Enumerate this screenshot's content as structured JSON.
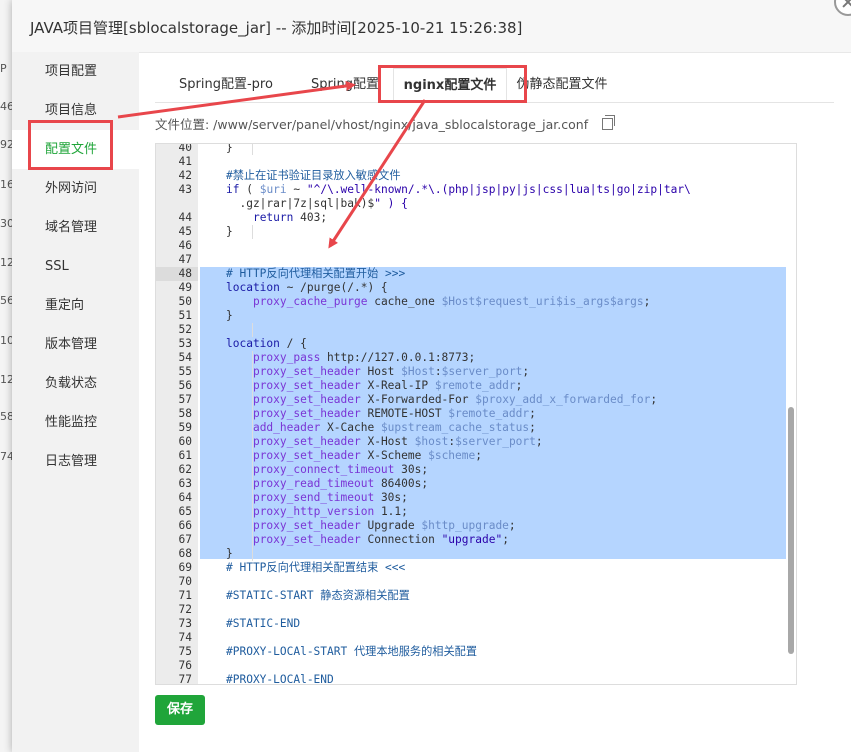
{
  "window": {
    "title": "JAVA项目管理[sblocalstorage_jar] -- 添加时间[2025-10-21 15:26:38]"
  },
  "background_numbers": [
    "P",
    "46",
    "92",
    "16",
    "30",
    "12",
    "56",
    "10",
    "12",
    "58",
    "74"
  ],
  "sidebar": {
    "items": [
      {
        "label": "项目配置"
      },
      {
        "label": "项目信息"
      },
      {
        "label": "配置文件",
        "active": true
      },
      {
        "label": "外网访问"
      },
      {
        "label": "域名管理"
      },
      {
        "label": "SSL"
      },
      {
        "label": "重定向"
      },
      {
        "label": "版本管理"
      },
      {
        "label": "负载状态"
      },
      {
        "label": "性能监控"
      },
      {
        "label": "日志管理"
      }
    ]
  },
  "tabs": [
    {
      "label": "Spring配置-pro"
    },
    {
      "label": "Spring配置"
    },
    {
      "label": "nginx配置文件",
      "active": true
    },
    {
      "label": "伪静态配置文件"
    }
  ],
  "file_path": {
    "label": "文件位置: /www/server/panel/vhost/nginx/java_sblocalstorage_jar.conf"
  },
  "editor": {
    "lines": [
      {
        "n": "40",
        "text": "    }"
      },
      {
        "n": "41",
        "text": ""
      },
      {
        "n": "42",
        "text": "    #禁止在证书验证目录放入敏感文件"
      },
      {
        "n": "43",
        "text": "    if ( $uri ~ \"^/\\.well-known/.*\\.(php|jsp|py|js|css|lua|ts|go|zip|tar\\"
      },
      {
        "n": "",
        "text": "      .gz|rar|7z|sql|bak)$\" ) {"
      },
      {
        "n": "44",
        "text": "        return 403;"
      },
      {
        "n": "45",
        "text": "    }"
      },
      {
        "n": "46",
        "text": ""
      },
      {
        "n": "47",
        "text": ""
      },
      {
        "n": "48",
        "text": "    # HTTP反向代理相关配置开始 >>>"
      },
      {
        "n": "49",
        "text": "    location ~ /purge(/.*) {"
      },
      {
        "n": "50",
        "text": "        proxy_cache_purge cache_one $Host$request_uri$is_args$args;"
      },
      {
        "n": "51",
        "text": "    }"
      },
      {
        "n": "52",
        "text": ""
      },
      {
        "n": "53",
        "text": "    location / {"
      },
      {
        "n": "54",
        "text": "        proxy_pass http://127.0.0.1:8773;"
      },
      {
        "n": "55",
        "text": "        proxy_set_header Host $Host:$server_port;"
      },
      {
        "n": "56",
        "text": "        proxy_set_header X-Real-IP $remote_addr;"
      },
      {
        "n": "57",
        "text": "        proxy_set_header X-Forwarded-For $proxy_add_x_forwarded_for;"
      },
      {
        "n": "58",
        "text": "        proxy_set_header REMOTE-HOST $remote_addr;"
      },
      {
        "n": "59",
        "text": "        add_header X-Cache $upstream_cache_status;"
      },
      {
        "n": "60",
        "text": "        proxy_set_header X-Host $host:$server_port;"
      },
      {
        "n": "61",
        "text": "        proxy_set_header X-Scheme $scheme;"
      },
      {
        "n": "62",
        "text": "        proxy_connect_timeout 30s;"
      },
      {
        "n": "63",
        "text": "        proxy_read_timeout 86400s;"
      },
      {
        "n": "64",
        "text": "        proxy_send_timeout 30s;"
      },
      {
        "n": "65",
        "text": "        proxy_http_version 1.1;"
      },
      {
        "n": "66",
        "text": "        proxy_set_header Upgrade $http_upgrade;"
      },
      {
        "n": "67",
        "text": "        proxy_set_header Connection \"upgrade\";"
      },
      {
        "n": "68",
        "text": "    }"
      },
      {
        "n": "69",
        "text": "    # HTTP反向代理相关配置结束 <<<"
      },
      {
        "n": "70",
        "text": ""
      },
      {
        "n": "71",
        "text": "    #STATIC-START 静态资源相关配置"
      },
      {
        "n": "72",
        "text": ""
      },
      {
        "n": "73",
        "text": "    #STATIC-END"
      },
      {
        "n": "74",
        "text": ""
      },
      {
        "n": "75",
        "text": "    #PROXY-LOCAl-START 代理本地服务的相关配置"
      },
      {
        "n": "76",
        "text": ""
      },
      {
        "n": "77",
        "text": "    #PROXY-LOCAl-END"
      }
    ]
  },
  "save_button": {
    "label": "保存"
  },
  "colors": {
    "accent": "#20a53a",
    "highlight": "#e8464b",
    "selection": "#b5d5ff"
  }
}
